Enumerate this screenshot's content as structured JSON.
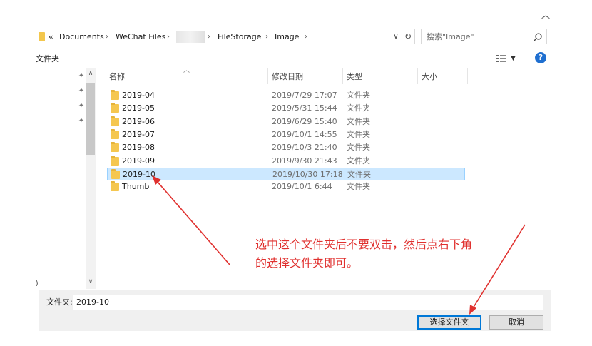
{
  "address_bar": {
    "overflow": "«",
    "crumbs": [
      "Documents",
      "WeChat Files",
      "FileStorage",
      "Image"
    ]
  },
  "search": {
    "placeholder": "搜索\"Image\""
  },
  "toolbar": {
    "label": "文件夹"
  },
  "help": {
    "glyph": "?"
  },
  "nav_pane": {
    "edge_text": ")"
  },
  "columns": {
    "name": "名称",
    "modified": "修改日期",
    "type": "类型",
    "size": "大小"
  },
  "files": [
    {
      "name": "2019-04",
      "modified": "2019/7/29 17:07",
      "type": "文件夹",
      "selected": false
    },
    {
      "name": "2019-05",
      "modified": "2019/5/31 15:44",
      "type": "文件夹",
      "selected": false
    },
    {
      "name": "2019-06",
      "modified": "2019/6/29 15:40",
      "type": "文件夹",
      "selected": false
    },
    {
      "name": "2019-07",
      "modified": "2019/10/1 14:55",
      "type": "文件夹",
      "selected": false
    },
    {
      "name": "2019-08",
      "modified": "2019/10/3 21:40",
      "type": "文件夹",
      "selected": false
    },
    {
      "name": "2019-09",
      "modified": "2019/9/30 21:43",
      "type": "文件夹",
      "selected": false
    },
    {
      "name": "2019-10",
      "modified": "2019/10/30 17:18",
      "type": "文件夹",
      "selected": true
    },
    {
      "name": "Thumb",
      "modified": "2019/10/1 6:44",
      "type": "文件夹",
      "selected": false
    }
  ],
  "annotation": {
    "line1": "选中这个文件夹后不要双击，然后点右下角",
    "line2": "的选择文件夹即可。"
  },
  "bottom": {
    "folder_label": "文件夹:",
    "folder_value": "2019-10",
    "select_button": "选择文件夹",
    "cancel_button": "取消"
  },
  "colors": {
    "selection_bg": "#cce8ff",
    "annotation_red": "#e0312f",
    "folder_yellow": "#f5c750",
    "primary_border": "#0078d7"
  }
}
